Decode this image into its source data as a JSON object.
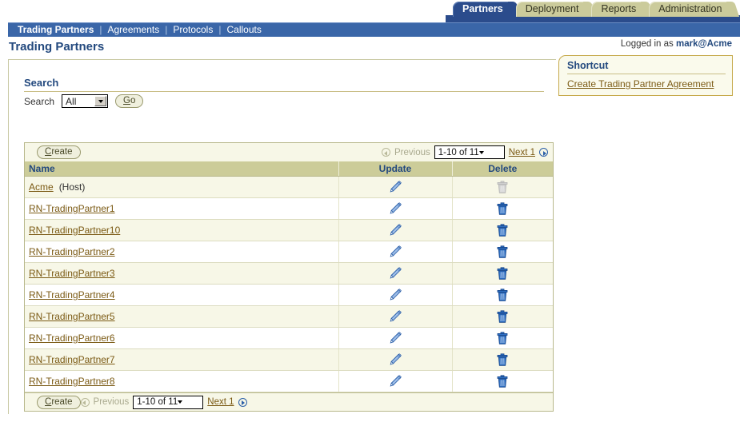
{
  "tabs": [
    {
      "label": "Partners",
      "active": true
    },
    {
      "label": "Deployment",
      "active": false
    },
    {
      "label": "Reports",
      "active": false
    },
    {
      "label": "Administration",
      "active": false
    }
  ],
  "subnav": [
    {
      "label": "Trading Partners",
      "current": true
    },
    {
      "label": "Agreements",
      "current": false
    },
    {
      "label": "Protocols",
      "current": false
    },
    {
      "label": "Callouts",
      "current": false
    }
  ],
  "subnav_separator": "|",
  "header": {
    "page_title": "Trading Partners",
    "logged_in_prefix": "Logged in as ",
    "logged_in_user": "mark@Acme"
  },
  "shortcut": {
    "title": "Shortcut",
    "link": "Create Trading Partner Agreement"
  },
  "search": {
    "heading": "Search",
    "label": "Search",
    "selected_option": "All",
    "options": [
      "All"
    ],
    "go_button_prefix": "G",
    "go_button_rest": "o",
    "go_button_label": "Go"
  },
  "toolbar": {
    "create_accel": "C",
    "create_rest": "reate",
    "create_label": "Create",
    "previous_label": "Previous",
    "range_label": "1-10 of 11",
    "next_label": "Next 1"
  },
  "table": {
    "columns": [
      "Name",
      "Update",
      "Delete"
    ],
    "rows": [
      {
        "name": "Acme",
        "suffix": " (Host)",
        "delete_enabled": false
      },
      {
        "name": "RN-TradingPartner1",
        "suffix": "",
        "delete_enabled": true
      },
      {
        "name": "RN-TradingPartner10",
        "suffix": "",
        "delete_enabled": true
      },
      {
        "name": "RN-TradingPartner2",
        "suffix": "",
        "delete_enabled": true
      },
      {
        "name": "RN-TradingPartner3",
        "suffix": "",
        "delete_enabled": true
      },
      {
        "name": "RN-TradingPartner4",
        "suffix": "",
        "delete_enabled": true
      },
      {
        "name": "RN-TradingPartner5",
        "suffix": "",
        "delete_enabled": true
      },
      {
        "name": "RN-TradingPartner6",
        "suffix": "",
        "delete_enabled": true
      },
      {
        "name": "RN-TradingPartner7",
        "suffix": "",
        "delete_enabled": true
      },
      {
        "name": "RN-TradingPartner8",
        "suffix": "",
        "delete_enabled": true
      }
    ]
  },
  "colors": {
    "active_tab": "#2B4C8C",
    "inactive_tab": "#CBCB9B",
    "subnav": "#3A66A8",
    "header_text": "#23497E",
    "link": "#7B5A14",
    "table_header_bg": "#CCCC99",
    "row_alt_bg": "#F7F7E7",
    "shortcut_border": "#C6A94A"
  }
}
